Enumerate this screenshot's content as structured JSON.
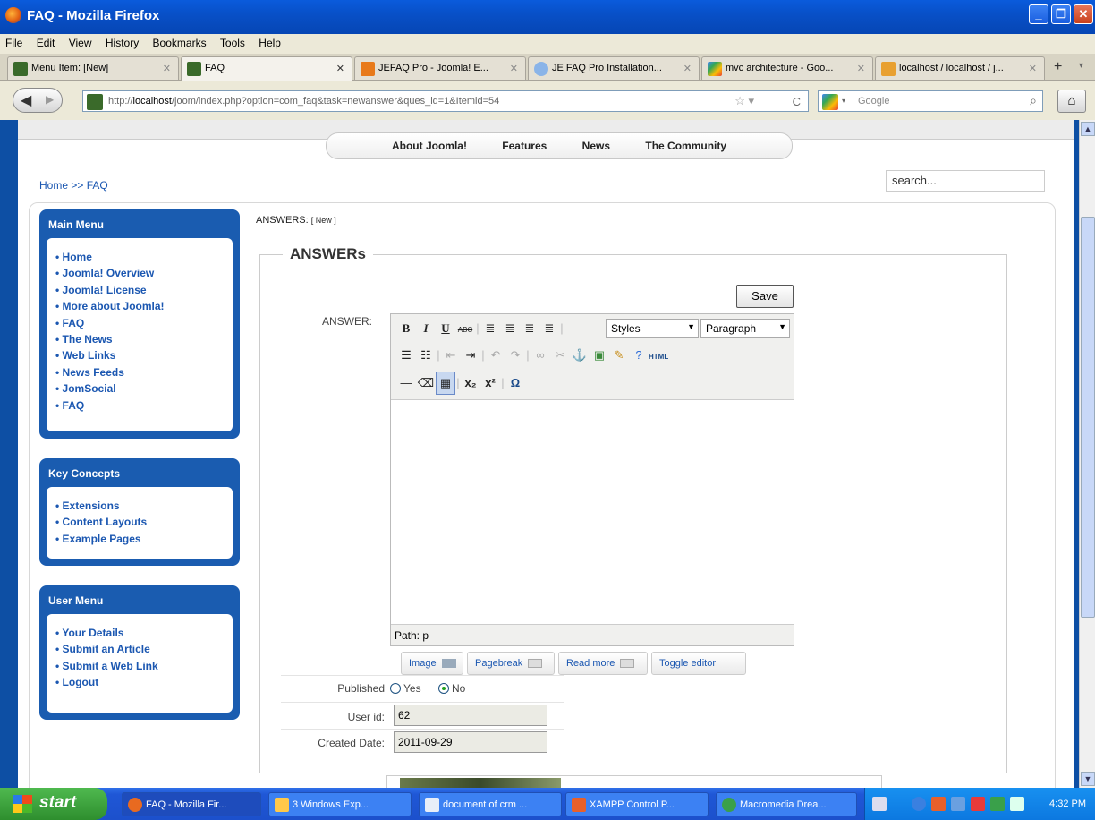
{
  "window": {
    "title": "FAQ - Mozilla Firefox"
  },
  "menubar": [
    "File",
    "Edit",
    "View",
    "History",
    "Bookmarks",
    "Tools",
    "Help"
  ],
  "tabs": [
    {
      "label": "Menu Item: [New]"
    },
    {
      "label": "FAQ"
    },
    {
      "label": "JEFAQ Pro - Joomla! E..."
    },
    {
      "label": "JE FAQ Pro Installation..."
    },
    {
      "label": "mvc architecture - Goo..."
    },
    {
      "label": "localhost / localhost / j..."
    }
  ],
  "navbar": {
    "url_prefix": "http://",
    "url_host": "localhost",
    "url_rest": "/joom/index.php?option=com_faq&task=newanswer&ques_id=1&Itemid=54",
    "search_placeholder": "Google"
  },
  "site": {
    "topnav": [
      "About Joomla!",
      "Features",
      "News",
      "The Community"
    ],
    "breadcrumb": "Home >> FAQ",
    "search_value": "search..."
  },
  "modules": {
    "main": {
      "title": "Main Menu",
      "items": [
        "Home",
        "Joomla! Overview",
        "Joomla! License",
        "More about Joomla!",
        "FAQ",
        "The News",
        "Web Links",
        "News Feeds",
        "JomSocial",
        "FAQ"
      ]
    },
    "key": {
      "title": "Key Concepts",
      "items": [
        "Extensions",
        "Content Layouts",
        "Example Pages"
      ]
    },
    "user": {
      "title": "User Menu",
      "items": [
        "Your Details",
        "Submit an Article",
        "Submit a Web Link",
        "Logout"
      ]
    }
  },
  "form": {
    "header": "ANSWERS:",
    "header_tag": "[ New ]",
    "legend": "ANSWERs",
    "save_label": "Save",
    "answer_label": "ANSWER:",
    "styles_select": "Styles",
    "paragraph_select": "Paragraph",
    "path_text": "Path: p",
    "buttons": [
      "Image",
      "Pagebreak",
      "Read more",
      "Toggle editor"
    ],
    "published_label": "Published",
    "published_yes": "Yes",
    "published_no": "No",
    "published_selected": "No",
    "userid_label": "User id:",
    "userid_value": "62",
    "created_label": "Created Date:",
    "created_value": "2011-09-29"
  },
  "taskbar": {
    "start_label": "start",
    "tasks": [
      "FAQ - Mozilla Fir...",
      "3 Windows Exp...",
      "document of crm ...",
      "XAMPP Control P...",
      "Macromedia Drea..."
    ],
    "clock": "4:32 PM"
  }
}
